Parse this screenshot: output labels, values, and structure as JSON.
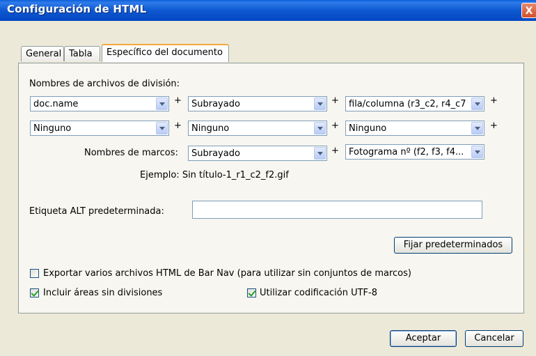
{
  "window": {
    "title": "Configuración de HTML",
    "close_label": "X"
  },
  "tabs": [
    {
      "label": "General"
    },
    {
      "label": "Tabla"
    },
    {
      "label": "Específico del documento"
    }
  ],
  "split_names": {
    "label": "Nombres de archivos de división:",
    "row1": [
      "doc.name",
      "Subrayado",
      "fila/columna (r3_c2, r4_c7"
    ],
    "row2": [
      "Ninguno",
      "Ninguno",
      "Ninguno"
    ],
    "plus": "+"
  },
  "frame_names": {
    "label": "Nombres de marcos:",
    "value1": "Subrayado",
    "value2": "Fotograma nº (f2, f3, f4..."
  },
  "example": "Ejemplo: Sin título-1_r1_c2_f2.gif",
  "alt_tag": {
    "label": "Etiqueta ALT predeterminada:",
    "value": ""
  },
  "set_defaults_label": "Fijar predeterminados",
  "checkboxes": {
    "export_multiple": {
      "label": "Exportar varios archivos HTML de Bar Nav (para utilizar sin conjuntos de marcos)",
      "checked": false
    },
    "include_undivided": {
      "label": "Incluir áreas sin divisiones",
      "checked": true
    },
    "utf8": {
      "label": "Utilizar codificación UTF-8",
      "checked": true
    }
  },
  "buttons": {
    "ok": "Aceptar",
    "cancel": "Cancelar"
  }
}
